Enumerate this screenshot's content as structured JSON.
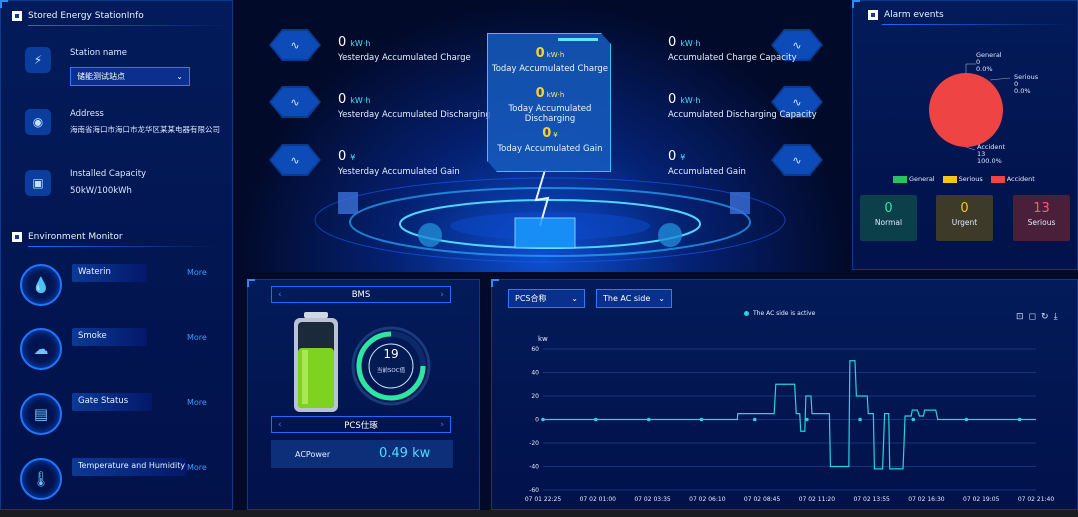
{
  "left": {
    "station_title": "Stored Energy StationInfo",
    "station_name_label": "Station name",
    "station_name_value": "储能测试站点",
    "address_label": "Address",
    "address_value": "海南省海口市海口市龙华区某某电器有限公司",
    "capacity_label": "Installed Capacity",
    "capacity_value": "50kW/100kWh",
    "env_title": "Environment Monitor",
    "env_items": [
      {
        "label": "Waterin",
        "more": "More",
        "icon": "water-drop-icon",
        "glyph": "💧"
      },
      {
        "label": "Smoke",
        "more": "More",
        "icon": "smoke-icon",
        "glyph": "☁"
      },
      {
        "label": "Gate Status",
        "more": "More",
        "icon": "gate-icon",
        "glyph": "▤"
      },
      {
        "label": "Temperature and Humidity",
        "more": "More",
        "icon": "thermometer-icon",
        "glyph": "🌡"
      }
    ]
  },
  "stats": {
    "left": [
      {
        "value": "0",
        "unit": "kW·h",
        "label": "Yesterday Accumulated Charge"
      },
      {
        "value": "0",
        "unit": "kW·h",
        "label": "Yesterday Accumulated Discharging"
      },
      {
        "value": "0",
        "unit": "¥",
        "label": "Yesterday Accumulated Gain"
      }
    ],
    "right": [
      {
        "value": "0",
        "unit": "kW·h",
        "label": "Accumulated Charge Capacity"
      },
      {
        "value": "0",
        "unit": "kW·h",
        "label": "Accumulated Discharging Capacity"
      },
      {
        "value": "0",
        "unit": "¥",
        "label": "Accumulated Gain"
      }
    ],
    "center": [
      {
        "value": "0",
        "unit": "kW·h",
        "label": "Today Accumulated Charge"
      },
      {
        "value": "0",
        "unit": "kW·h",
        "label": "Today Accumulated Discharging"
      },
      {
        "value": "0",
        "unit": "¥",
        "label": "Today Accumulated Gain"
      }
    ]
  },
  "alarm": {
    "title": "Alarm events",
    "pie_labels": [
      {
        "name": "General",
        "count": "0",
        "pct": "0.0%"
      },
      {
        "name": "Serious",
        "count": "0",
        "pct": "0.0%"
      },
      {
        "name": "Accident",
        "count": "13",
        "pct": "100.0%"
      }
    ],
    "legend": [
      {
        "name": "General",
        "color": "#22c55e"
      },
      {
        "name": "Serious",
        "color": "#f5c518"
      },
      {
        "name": "Accident",
        "color": "#ef4444"
      }
    ],
    "boxes": [
      {
        "value": "0",
        "label": "Normal",
        "color": "#2ee6a8",
        "bg": "#0b3f4a"
      },
      {
        "value": "0",
        "label": "Urgent",
        "color": "#ffc21a",
        "bg": "#3d3a2a"
      },
      {
        "value": "13",
        "label": "Serious",
        "color": "#ff5a6a",
        "bg": "#4a1f3a"
      }
    ]
  },
  "bms": {
    "title": "BMS",
    "soc_value": "19",
    "soc_label": "当前SOC值",
    "pcs_title": "PCS仕琢",
    "ac_power_label": "ACPower",
    "ac_power_value": "0.49 kw"
  },
  "chart_panel": {
    "pcs_select": "PCS合称",
    "side_select": "The AC side",
    "toolbar": [
      "⊡",
      "◻",
      "↻",
      "⤓"
    ]
  },
  "chart_data": {
    "type": "line",
    "title": "",
    "legend": "The AC side is active",
    "ylabel": "kw",
    "ylim": [
      -60,
      60
    ],
    "yticks": [
      "60",
      "40",
      "20",
      "0",
      "-20",
      "-40",
      "-60"
    ],
    "yticks_values": [
      60,
      40,
      20,
      0,
      -20,
      -40,
      -60
    ],
    "xtick_labels": [
      "07 01 22:25",
      "07 02 01:00",
      "07 02 03:35",
      "07 02 06:10",
      "07 02 08:45",
      "07 02 11:20",
      "07 02 13:55",
      "07 02 16:30",
      "07 02 19:05",
      "07 02 21:40"
    ],
    "x_range_hours": [
      0,
      24.1
    ],
    "series": [
      {
        "x": [
          0,
          2.58,
          5.17,
          7.75,
          9.5,
          9.52,
          9.9,
          10.35,
          10.6,
          11.3,
          11.38,
          12.3,
          12.38,
          12.55,
          12.6,
          12.8,
          12.85,
          13.1,
          13.15,
          14.0,
          14.05,
          14.95,
          15.0,
          15.25,
          15.32,
          15.6,
          15.7,
          15.85,
          15.9,
          16.15,
          16.2,
          16.6,
          16.7,
          16.9,
          16.95,
          17.6,
          17.7,
          18.0,
          18.05,
          18.3,
          18.4,
          18.6,
          18.65,
          19.2,
          19.3,
          21.8,
          24.1
        ],
        "y": [
          0,
          0,
          0,
          0,
          0,
          5,
          5,
          5,
          5,
          5,
          30,
          30,
          5,
          5,
          -10,
          -10,
          20,
          20,
          5,
          5,
          -40,
          -40,
          50,
          50,
          20,
          20,
          20,
          20,
          5,
          5,
          -42,
          -42,
          5,
          5,
          -42,
          -42,
          3,
          3,
          8,
          8,
          3,
          3,
          8,
          8,
          0,
          0,
          0
        ],
        "markers_x": [
          0,
          2.58,
          5.17,
          7.75,
          10.35,
          12.9,
          15.5,
          18.1,
          20.7,
          23.3
        ],
        "color": "#23d5e0"
      }
    ]
  }
}
